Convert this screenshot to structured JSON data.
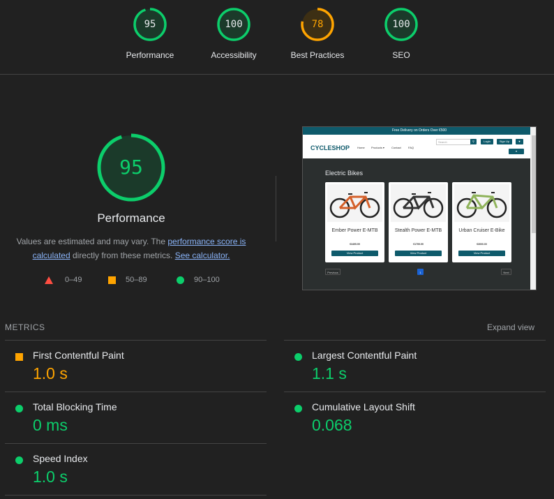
{
  "scores": [
    {
      "label": "Performance",
      "score": 95,
      "fraction": 0.95,
      "color": "#0cce6b"
    },
    {
      "label": "Accessibility",
      "score": 100,
      "fraction": 1.0,
      "color": "#0cce6b"
    },
    {
      "label": "Best Practices",
      "score": 78,
      "fraction": 0.78,
      "color": "#ffa400"
    },
    {
      "label": "SEO",
      "score": 100,
      "fraction": 1.0,
      "color": "#0cce6b"
    }
  ],
  "performance": {
    "score": "95",
    "fraction": 0.95,
    "title": "Performance",
    "desc_prefix": "Values are estimated and may vary. The ",
    "link1": "performance score is calculated",
    "desc_mid": " directly from these metrics. ",
    "link2": "See calculator."
  },
  "legend": [
    {
      "shape": "triangle",
      "range": "0–49",
      "color": "#ff4e42"
    },
    {
      "shape": "square",
      "range": "50–89",
      "color": "#ffa400"
    },
    {
      "shape": "circle",
      "range": "90–100",
      "color": "#0cce6b"
    }
  ],
  "thumbnail": {
    "promo": "Free Delivery on Orders Over €500",
    "brand": "CYCLESHOP",
    "nav": [
      "Home",
      "Products ▾",
      "Contact",
      "FAQ"
    ],
    "search_placeholder": "Search",
    "login": "Login",
    "signup": "Sign Up",
    "heading": "Electric Bikes",
    "products": [
      {
        "name": "Ember Power E-MTB",
        "price": "€3495.99",
        "button": "View Product",
        "frame_color": "#d4602a"
      },
      {
        "name": "Stealth Power E-MTB",
        "price": "€1799.99",
        "button": "View Product",
        "frame_color": "#333333"
      },
      {
        "name": "Urban Cruiser E-Bike",
        "price": "€3000.00",
        "button": "View Product",
        "frame_color": "#8fb35a"
      }
    ],
    "prev": "Previous",
    "page": "1",
    "next": "Next"
  },
  "metrics": {
    "title": "METRICS",
    "expand": "Expand view",
    "items": [
      {
        "label": "First Contentful Paint",
        "value": "1.0 s",
        "rating": "average",
        "color": "#ffa400"
      },
      {
        "label": "Largest Contentful Paint",
        "value": "1.1 s",
        "rating": "pass",
        "color": "#0cce6b"
      },
      {
        "label": "Total Blocking Time",
        "value": "0 ms",
        "rating": "pass",
        "color": "#0cce6b"
      },
      {
        "label": "Cumulative Layout Shift",
        "value": "0.068",
        "rating": "pass",
        "color": "#0cce6b"
      },
      {
        "label": "Speed Index",
        "value": "1.0 s",
        "rating": "pass",
        "color": "#0cce6b"
      }
    ]
  }
}
